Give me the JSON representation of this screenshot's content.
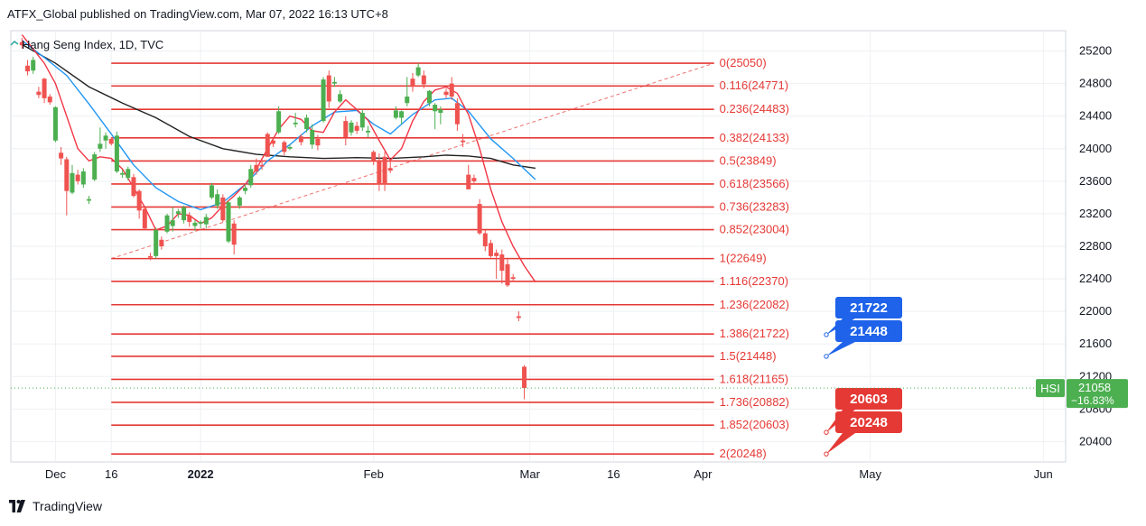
{
  "header": {
    "published": "ATFX_Global published on TradingView.com, Mar 07, 2022 16:13 UTC+8"
  },
  "legend": {
    "symbol_title": "Hang Seng Index, 1D, TVC"
  },
  "footer": {
    "brand": "TradingView"
  },
  "colors": {
    "up": "#4caf50",
    "down": "#ef5350",
    "fib": "#e53935",
    "ema_black": "#222222",
    "ema_blue": "#2196f3",
    "ema_red": "#f23645",
    "callout_blue": "#1e63e9",
    "callout_red": "#e53935",
    "grid": "#eef0f3",
    "tag_green": "#4caf50"
  },
  "chart_data": {
    "type": "candlestick",
    "title": "Hang Seng Index, 1D, TVC",
    "symbol": "HSI",
    "ylim": [
      20150,
      25450
    ],
    "y_ticks": [
      20400,
      20800,
      21200,
      21600,
      22000,
      22400,
      22800,
      23200,
      23600,
      24000,
      24400,
      24800,
      25200
    ],
    "x_ticks": [
      {
        "label": "Dec",
        "day": 6
      },
      {
        "label": "16",
        "day": 16
      },
      {
        "label": "2022",
        "day": 32
      },
      {
        "label": "Feb",
        "day": 63
      },
      {
        "label": "Mar",
        "day": 91
      },
      {
        "label": "16",
        "day": 106
      },
      {
        "label": "Apr",
        "day": 122
      },
      {
        "label": "May",
        "day": 152
      },
      {
        "label": "Jun",
        "day": 183
      }
    ],
    "fib_levels": [
      {
        "ratio": "0",
        "value": 25050,
        "label": "0(25050)"
      },
      {
        "ratio": "0.116",
        "value": 24771,
        "label": "0.116(24771)"
      },
      {
        "ratio": "0.236",
        "value": 24483,
        "label": "0.236(24483)"
      },
      {
        "ratio": "0.382",
        "value": 24133,
        "label": "0.382(24133)"
      },
      {
        "ratio": "0.5",
        "value": 23849,
        "label": "0.5(23849)"
      },
      {
        "ratio": "0.618",
        "value": 23566,
        "label": "0.618(23566)"
      },
      {
        "ratio": "0.736",
        "value": 23283,
        "label": "0.736(23283)"
      },
      {
        "ratio": "0.852",
        "value": 23004,
        "label": "0.852(23004)"
      },
      {
        "ratio": "1",
        "value": 22649,
        "label": "1(22649)"
      },
      {
        "ratio": "1.116",
        "value": 22370,
        "label": "1.116(22370)"
      },
      {
        "ratio": "1.236",
        "value": 22082,
        "label": "1.236(22082)"
      },
      {
        "ratio": "1.386",
        "value": 21722,
        "label": "1.386(21722)"
      },
      {
        "ratio": "1.5",
        "value": 21448,
        "label": "1.5(21448)"
      },
      {
        "ratio": "1.618",
        "value": 21165,
        "label": "1.618(21165)"
      },
      {
        "ratio": "1.736",
        "value": 20882,
        "label": "1.736(20882)"
      },
      {
        "ratio": "1.852",
        "value": 20603,
        "label": "1.852(20603)"
      },
      {
        "ratio": "2",
        "value": 20248,
        "label": "2(20248)"
      }
    ],
    "fib_day_range": [
      16,
      124
    ],
    "trend_line": {
      "from": {
        "day": 16,
        "value": 22649
      },
      "to": {
        "day": 124,
        "value": 25050
      }
    },
    "callouts": [
      {
        "value": "21722",
        "color": "blue",
        "level": 21448
      },
      {
        "value": "21448",
        "color": "blue",
        "level": 21448
      },
      {
        "value": "20603",
        "color": "red",
        "level": 20248
      },
      {
        "value": "20248",
        "color": "red",
        "level": 20248
      }
    ],
    "last_price": {
      "symbol": "HSI",
      "value": "21058",
      "change": "−16.83%"
    },
    "candles": [
      {
        "d": 0,
        "o": 25310,
        "h": 25360,
        "l": 25230,
        "c": 25270
      },
      {
        "d": 1,
        "o": 25020,
        "h": 25090,
        "l": 24900,
        "c": 24950
      },
      {
        "d": 2,
        "o": 24960,
        "h": 25130,
        "l": 24920,
        "c": 25090
      },
      {
        "d": 3,
        "o": 24700,
        "h": 24760,
        "l": 24620,
        "c": 24660
      },
      {
        "d": 4,
        "o": 24860,
        "h": 24870,
        "l": 24560,
        "c": 24620
      },
      {
        "d": 5,
        "o": 24640,
        "h": 24670,
        "l": 24540,
        "c": 24570
      },
      {
        "d": 6,
        "o": 24100,
        "h": 24520,
        "l": 24080,
        "c": 24510
      },
      {
        "d": 7,
        "o": 23950,
        "h": 24020,
        "l": 23800,
        "c": 23880
      },
      {
        "d": 8,
        "o": 23870,
        "h": 23900,
        "l": 23180,
        "c": 23480
      },
      {
        "d": 9,
        "o": 23460,
        "h": 23800,
        "l": 23440,
        "c": 23700
      },
      {
        "d": 10,
        "o": 23680,
        "h": 23740,
        "l": 23560,
        "c": 23600
      },
      {
        "d": 11,
        "o": 23560,
        "h": 23760,
        "l": 23520,
        "c": 23720
      },
      {
        "d": 12,
        "o": 23360,
        "h": 23420,
        "l": 23320,
        "c": 23380
      },
      {
        "d": 13,
        "o": 23620,
        "h": 23960,
        "l": 23600,
        "c": 23930
      },
      {
        "d": 14,
        "o": 24000,
        "h": 24260,
        "l": 23960,
        "c": 24060
      },
      {
        "d": 15,
        "o": 24100,
        "h": 24200,
        "l": 24000,
        "c": 24160
      },
      {
        "d": 16,
        "o": 24120,
        "h": 24140,
        "l": 24040,
        "c": 24060
      },
      {
        "d": 17,
        "o": 23720,
        "h": 24210,
        "l": 23700,
        "c": 24160
      },
      {
        "d": 18,
        "o": 23680,
        "h": 23740,
        "l": 23640,
        "c": 23700
      },
      {
        "d": 19,
        "o": 23640,
        "h": 23780,
        "l": 23610,
        "c": 23750
      },
      {
        "d": 20,
        "o": 23650,
        "h": 23690,
        "l": 23400,
        "c": 23420
      },
      {
        "d": 21,
        "o": 23480,
        "h": 23500,
        "l": 23140,
        "c": 23240
      },
      {
        "d": 22,
        "o": 23260,
        "h": 23280,
        "l": 23000,
        "c": 23020
      },
      {
        "d": 23,
        "o": 22680,
        "h": 22720,
        "l": 22630,
        "c": 22660
      },
      {
        "d": 24,
        "o": 22680,
        "h": 23030,
        "l": 22650,
        "c": 23000
      },
      {
        "d": 25,
        "o": 22880,
        "h": 22920,
        "l": 22760,
        "c": 22800
      },
      {
        "d": 26,
        "o": 22980,
        "h": 23200,
        "l": 22960,
        "c": 23180
      },
      {
        "d": 27,
        "o": 23050,
        "h": 23280,
        "l": 22980,
        "c": 23120
      },
      {
        "d": 28,
        "o": 23200,
        "h": 23260,
        "l": 23150,
        "c": 23230
      },
      {
        "d": 29,
        "o": 23120,
        "h": 23300,
        "l": 23080,
        "c": 23280
      },
      {
        "d": 30,
        "o": 23180,
        "h": 23220,
        "l": 23040,
        "c": 23100
      },
      {
        "d": 31,
        "o": 23050,
        "h": 23120,
        "l": 22990,
        "c": 23090
      },
      {
        "d": 32,
        "o": 23080,
        "h": 23120,
        "l": 23020,
        "c": 23100
      },
      {
        "d": 33,
        "o": 23070,
        "h": 23200,
        "l": 23020,
        "c": 23160
      },
      {
        "d": 34,
        "o": 23400,
        "h": 23580,
        "l": 23380,
        "c": 23550
      },
      {
        "d": 35,
        "o": 23300,
        "h": 23500,
        "l": 23260,
        "c": 23440
      },
      {
        "d": 36,
        "o": 23400,
        "h": 23440,
        "l": 23100,
        "c": 23120
      },
      {
        "d": 37,
        "o": 22860,
        "h": 23360,
        "l": 22840,
        "c": 23340
      },
      {
        "d": 38,
        "o": 23080,
        "h": 23120,
        "l": 22700,
        "c": 22820
      },
      {
        "d": 39,
        "o": 23300,
        "h": 23420,
        "l": 23260,
        "c": 23400
      },
      {
        "d": 40,
        "o": 23480,
        "h": 23560,
        "l": 23440,
        "c": 23520
      },
      {
        "d": 41,
        "o": 23550,
        "h": 23800,
        "l": 23520,
        "c": 23750
      },
      {
        "d": 42,
        "o": 23800,
        "h": 23880,
        "l": 23680,
        "c": 23720
      },
      {
        "d": 43,
        "o": 23800,
        "h": 23860,
        "l": 23740,
        "c": 23780
      },
      {
        "d": 44,
        "o": 24180,
        "h": 24200,
        "l": 23900,
        "c": 23900
      },
      {
        "d": 45,
        "o": 24100,
        "h": 24120,
        "l": 24020,
        "c": 24060
      },
      {
        "d": 46,
        "o": 24200,
        "h": 24520,
        "l": 24180,
        "c": 24460
      },
      {
        "d": 47,
        "o": 24080,
        "h": 24100,
        "l": 23920,
        "c": 23960
      },
      {
        "d": 48,
        "o": 24000,
        "h": 24050,
        "l": 23980,
        "c": 24020
      },
      {
        "d": 49,
        "o": 24300,
        "h": 24440,
        "l": 24260,
        "c": 24320
      },
      {
        "d": 50,
        "o": 24150,
        "h": 24180,
        "l": 24040,
        "c": 24080
      },
      {
        "d": 51,
        "o": 24240,
        "h": 24420,
        "l": 24200,
        "c": 24380
      },
      {
        "d": 52,
        "o": 24050,
        "h": 24300,
        "l": 24000,
        "c": 24230
      },
      {
        "d": 53,
        "o": 24120,
        "h": 24170,
        "l": 23980,
        "c": 24040
      },
      {
        "d": 54,
        "o": 24340,
        "h": 24880,
        "l": 24320,
        "c": 24850
      },
      {
        "d": 55,
        "o": 24900,
        "h": 24960,
        "l": 24500,
        "c": 24580
      },
      {
        "d": 56,
        "o": 24800,
        "h": 24880,
        "l": 24760,
        "c": 24820
      },
      {
        "d": 57,
        "o": 24580,
        "h": 24720,
        "l": 24560,
        "c": 24670
      },
      {
        "d": 58,
        "o": 24340,
        "h": 24400,
        "l": 24040,
        "c": 24140
      },
      {
        "d": 59,
        "o": 24200,
        "h": 24350,
        "l": 24160,
        "c": 24320
      },
      {
        "d": 60,
        "o": 24280,
        "h": 24330,
        "l": 24180,
        "c": 24220
      },
      {
        "d": 61,
        "o": 24260,
        "h": 24480,
        "l": 24220,
        "c": 24440
      },
      {
        "d": 62,
        "o": 24200,
        "h": 24280,
        "l": 24140,
        "c": 24220
      },
      {
        "d": 63,
        "o": 23960,
        "h": 23980,
        "l": 23800,
        "c": 23850
      },
      {
        "d": 64,
        "o": 23860,
        "h": 23940,
        "l": 23480,
        "c": 23560
      },
      {
        "d": 65,
        "o": 23900,
        "h": 23960,
        "l": 23480,
        "c": 23560
      },
      {
        "d": 66,
        "o": 23760,
        "h": 23850,
        "l": 23700,
        "c": 23730
      },
      {
        "d": 67,
        "o": 24380,
        "h": 24520,
        "l": 24360,
        "c": 24470
      },
      {
        "d": 68,
        "o": 24380,
        "h": 24470,
        "l": 24300,
        "c": 24460
      },
      {
        "d": 69,
        "o": 24560,
        "h": 24880,
        "l": 24520,
        "c": 24640
      },
      {
        "d": 70,
        "o": 24860,
        "h": 24930,
        "l": 24700,
        "c": 24760
      },
      {
        "d": 71,
        "o": 24900,
        "h": 25050,
        "l": 24880,
        "c": 25000
      },
      {
        "d": 72,
        "o": 24900,
        "h": 24960,
        "l": 24740,
        "c": 24790
      },
      {
        "d": 73,
        "o": 24560,
        "h": 24720,
        "l": 24520,
        "c": 24710
      },
      {
        "d": 74,
        "o": 24460,
        "h": 24560,
        "l": 24240,
        "c": 24540
      },
      {
        "d": 75,
        "o": 24440,
        "h": 24520,
        "l": 24300,
        "c": 24480
      },
      {
        "d": 76,
        "o": 24700,
        "h": 24740,
        "l": 24620,
        "c": 24660
      },
      {
        "d": 77,
        "o": 24800,
        "h": 24880,
        "l": 24600,
        "c": 24640
      },
      {
        "d": 78,
        "o": 24560,
        "h": 24620,
        "l": 24220,
        "c": 24300
      },
      {
        "d": 79,
        "o": 24100,
        "h": 24180,
        "l": 24020,
        "c": 24080
      },
      {
        "d": 80,
        "o": 23680,
        "h": 23800,
        "l": 23520,
        "c": 23500
      },
      {
        "d": 81,
        "o": 23640,
        "h": 23680,
        "l": 23560,
        "c": 23600
      },
      {
        "d": 82,
        "o": 23320,
        "h": 23380,
        "l": 22940,
        "c": 22960
      },
      {
        "d": 83,
        "o": 22960,
        "h": 23000,
        "l": 22740,
        "c": 22800
      },
      {
        "d": 84,
        "o": 22840,
        "h": 22880,
        "l": 22660,
        "c": 22680
      },
      {
        "d": 85,
        "o": 22720,
        "h": 22760,
        "l": 22400,
        "c": 22680
      },
      {
        "d": 86,
        "o": 22700,
        "h": 22760,
        "l": 22340,
        "c": 22500
      },
      {
        "d": 87,
        "o": 22580,
        "h": 22660,
        "l": 22300,
        "c": 22320
      },
      {
        "d": 88,
        "o": 22420,
        "h": 22460,
        "l": 22380,
        "c": 22400
      },
      {
        "d": 89,
        "o": 21940,
        "h": 22000,
        "l": 21880,
        "c": 21920
      },
      {
        "d": 90,
        "o": 21320,
        "h": 21340,
        "l": 20920,
        "c": 21058
      }
    ],
    "ema_black": [
      [
        0,
        25280
      ],
      [
        6,
        25050
      ],
      [
        12,
        24760
      ],
      [
        18,
        24560
      ],
      [
        24,
        24380
      ],
      [
        30,
        24150
      ],
      [
        36,
        24000
      ],
      [
        42,
        23930
      ],
      [
        48,
        23900
      ],
      [
        54,
        23880
      ],
      [
        60,
        23890
      ],
      [
        66,
        23880
      ],
      [
        72,
        23900
      ],
      [
        76,
        23920
      ],
      [
        80,
        23910
      ],
      [
        84,
        23880
      ],
      [
        88,
        23800
      ],
      [
        92,
        23760
      ]
    ],
    "ema_blue": [
      [
        0,
        25330
      ],
      [
        4,
        25120
      ],
      [
        8,
        24900
      ],
      [
        12,
        24550
      ],
      [
        16,
        24180
      ],
      [
        20,
        23800
      ],
      [
        24,
        23520
      ],
      [
        28,
        23350
      ],
      [
        32,
        23250
      ],
      [
        36,
        23340
      ],
      [
        40,
        23560
      ],
      [
        44,
        23850
      ],
      [
        48,
        24050
      ],
      [
        52,
        24280
      ],
      [
        56,
        24450
      ],
      [
        60,
        24470
      ],
      [
        63,
        24300
      ],
      [
        66,
        24180
      ],
      [
        70,
        24420
      ],
      [
        74,
        24600
      ],
      [
        77,
        24620
      ],
      [
        80,
        24460
      ],
      [
        84,
        24120
      ],
      [
        88,
        23880
      ],
      [
        92,
        23620
      ]
    ],
    "ema_red": [
      [
        0,
        25400
      ],
      [
        4,
        25050
      ],
      [
        6,
        24800
      ],
      [
        8,
        24400
      ],
      [
        10,
        24000
      ],
      [
        12,
        23850
      ],
      [
        14,
        23900
      ],
      [
        16,
        23880
      ],
      [
        18,
        23750
      ],
      [
        20,
        23520
      ],
      [
        22,
        23280
      ],
      [
        24,
        23000
      ],
      [
        26,
        23050
      ],
      [
        28,
        23200
      ],
      [
        30,
        23180
      ],
      [
        32,
        23080
      ],
      [
        34,
        23150
      ],
      [
        36,
        23300
      ],
      [
        38,
        23420
      ],
      [
        40,
        23560
      ],
      [
        42,
        23750
      ],
      [
        44,
        24000
      ],
      [
        46,
        24240
      ],
      [
        48,
        24400
      ],
      [
        50,
        24360
      ],
      [
        52,
        24220
      ],
      [
        54,
        24200
      ],
      [
        56,
        24450
      ],
      [
        58,
        24600
      ],
      [
        60,
        24480
      ],
      [
        62,
        24350
      ],
      [
        64,
        24100
      ],
      [
        66,
        23860
      ],
      [
        68,
        24000
      ],
      [
        70,
        24340
      ],
      [
        72,
        24580
      ],
      [
        74,
        24720
      ],
      [
        76,
        24760
      ],
      [
        78,
        24680
      ],
      [
        80,
        24420
      ],
      [
        82,
        24000
      ],
      [
        84,
        23500
      ],
      [
        86,
        23100
      ],
      [
        88,
        22800
      ],
      [
        90,
        22560
      ],
      [
        92,
        22360
      ]
    ]
  }
}
